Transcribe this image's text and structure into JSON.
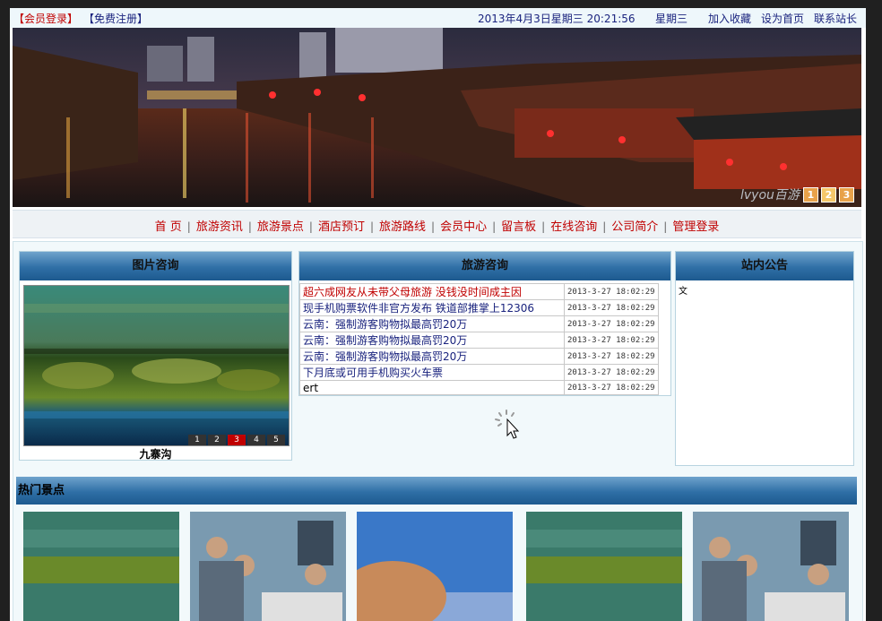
{
  "topbar": {
    "login_label": "【会员登录】",
    "register_label": "【免费注册】",
    "datetime": "2013年4月3日星期三 20:21:56",
    "weekday": "星期三",
    "links": [
      "加入收藏",
      "设为首页",
      "联系站长"
    ]
  },
  "banner": {
    "logo_text": "lvyou百游",
    "pager": [
      "1",
      "2",
      "3"
    ],
    "active_page": "2"
  },
  "nav": {
    "items": [
      "首 页",
      "旅游资讯",
      "旅游景点",
      "酒店预订",
      "旅游路线",
      "会员中心",
      "留言板",
      "在线咨询",
      "公司简介",
      "管理登录"
    ],
    "separator": "|"
  },
  "pic_panel": {
    "title": "图片咨询",
    "caption": "九寨沟",
    "pager": [
      "1",
      "2",
      "3",
      "4",
      "5"
    ],
    "active_page": "3"
  },
  "tour_panel": {
    "title": "旅游咨询",
    "rows": [
      {
        "title": "超六成网友从未带父母旅游 没钱没时间成主因",
        "date": "2013-3-27 18:02:29",
        "color": "red"
      },
      {
        "title": "现手机购票软件非官方发布 铁道部推掌上12306",
        "date": "2013-3-27 18:02:29",
        "color": "blue"
      },
      {
        "title": "云南：强制游客购物拟最高罚20万",
        "date": "2013-3-27 18:02:29",
        "color": "blue"
      },
      {
        "title": "云南：强制游客购物拟最高罚20万",
        "date": "2013-3-27 18:02:29",
        "color": "blue"
      },
      {
        "title": "云南：强制游客购物拟最高罚20万",
        "date": "2013-3-27 18:02:29",
        "color": "blue"
      },
      {
        "title": "下月底或可用手机购买火车票",
        "date": "2013-3-27 18:02:29",
        "color": "blue"
      },
      {
        "title": "ert",
        "date": "2013-3-27 18:02:29",
        "color": "black"
      }
    ]
  },
  "notice_panel": {
    "title": "站内公告",
    "mark": "文"
  },
  "hot": {
    "title": "热门景点"
  },
  "colors": {
    "accent_red": "#c00000",
    "link_blue": "#1a237e",
    "header_blue": "#2f6fa6"
  }
}
